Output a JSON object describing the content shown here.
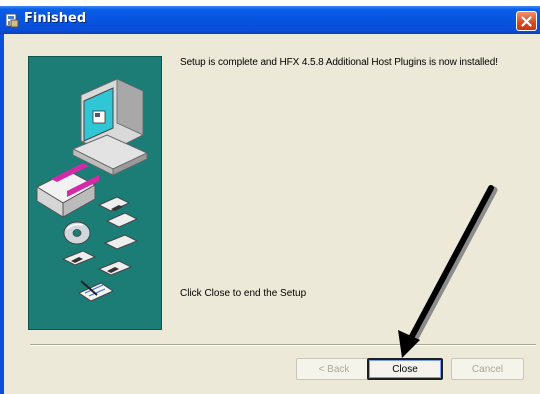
{
  "window": {
    "title": "Finished",
    "icons": {
      "app": "setup-icon",
      "close": "close-x-icon"
    }
  },
  "content": {
    "message_installed": "Setup is complete and HFX 4.5.8 Additional Host Plugins is now installed!",
    "message_close": "Click Close to end the Setup",
    "illustration": "computer-with-disks-illustration"
  },
  "buttons": {
    "back": "< Back",
    "close": "Close",
    "cancel": "Cancel"
  },
  "annotation": {
    "icon": "pointer-arrow-icon"
  },
  "colors": {
    "titlebar": "#0653e0",
    "panel": "#1b7d75",
    "dialog": "#ece9d8",
    "close_x": "#d84a20"
  }
}
